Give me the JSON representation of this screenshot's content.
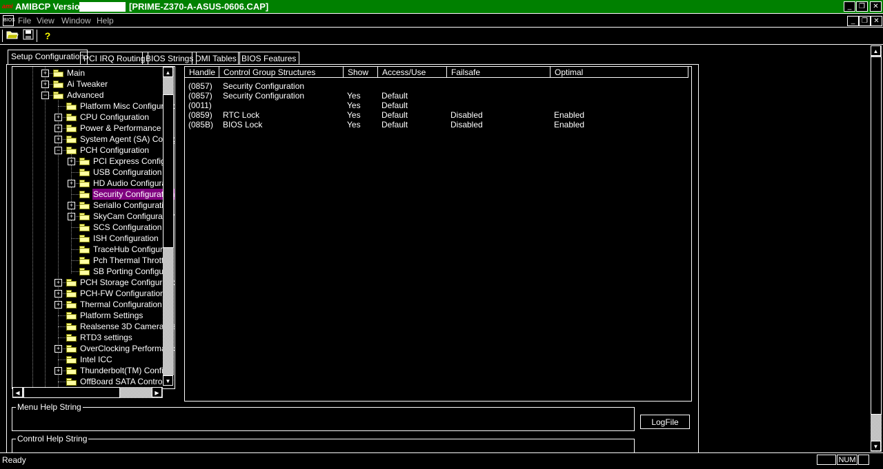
{
  "window": {
    "title_prefix": "AMIBCP Version",
    "title_file": "[PRIME-Z370-A-ASUS-0606.CAP]",
    "logo": "ami",
    "minimize_icon": "minimize-icon",
    "restore_icon": "restore-icon",
    "close_icon": "close-icon"
  },
  "menu": {
    "logo": "BIOS",
    "items": [
      "File",
      "View",
      "Window",
      "Help"
    ]
  },
  "toolbar": {
    "icons": [
      "open-folder-icon",
      "save-icon",
      "help-icon"
    ]
  },
  "tabs": [
    "Setup Configuration",
    "PCI IRQ Routing",
    "BIOS Strings",
    "DMI Tables",
    "BIOS Features"
  ],
  "active_tab": "Setup Configuration",
  "tree": {
    "items": [
      {
        "label": "Main",
        "level": 0,
        "expander": "+"
      },
      {
        "label": "Ai Tweaker",
        "level": 0,
        "expander": "+"
      },
      {
        "label": "Advanced",
        "level": 0,
        "expander": "-"
      },
      {
        "label": "Platform Misc Configuratio",
        "level": 1,
        "expander": ""
      },
      {
        "label": "CPU Configuration",
        "level": 1,
        "expander": "+"
      },
      {
        "label": "Power & Performance",
        "level": 1,
        "expander": "+"
      },
      {
        "label": "System Agent (SA) Config",
        "level": 1,
        "expander": "+"
      },
      {
        "label": "PCH Configuration",
        "level": 1,
        "expander": "-"
      },
      {
        "label": "PCI Express Configur",
        "level": 2,
        "expander": "+"
      },
      {
        "label": "USB Configuration",
        "level": 2,
        "expander": ""
      },
      {
        "label": "HD Audio Configurati",
        "level": 2,
        "expander": "+"
      },
      {
        "label": "Security Configuration",
        "level": 2,
        "expander": "",
        "selected": true
      },
      {
        "label": "SerialIo Configuration",
        "level": 2,
        "expander": "+"
      },
      {
        "label": "SkyCam Configuration",
        "level": 2,
        "expander": "+"
      },
      {
        "label": "SCS Configuration",
        "level": 2,
        "expander": ""
      },
      {
        "label": "ISH Configuration",
        "level": 2,
        "expander": ""
      },
      {
        "label": "TraceHub Configurati",
        "level": 2,
        "expander": ""
      },
      {
        "label": "Pch Thermal Throttlin",
        "level": 2,
        "expander": ""
      },
      {
        "label": "SB Porting Configurat",
        "level": 2,
        "expander": ""
      },
      {
        "label": "PCH Storage Configuratio",
        "level": 1,
        "expander": "+"
      },
      {
        "label": "PCH-FW Configuration",
        "level": 1,
        "expander": "+"
      },
      {
        "label": "Thermal Configuration",
        "level": 1,
        "expander": "+"
      },
      {
        "label": "Platform Settings",
        "level": 1,
        "expander": ""
      },
      {
        "label": "Realsense 3D Camera Se",
        "level": 1,
        "expander": ""
      },
      {
        "label": "RTD3 settings",
        "level": 1,
        "expander": ""
      },
      {
        "label": "OverClocking Performanc",
        "level": 1,
        "expander": "+"
      },
      {
        "label": "Intel ICC",
        "level": 1,
        "expander": ""
      },
      {
        "label": "Thunderbolt(TM) Configu",
        "level": 1,
        "expander": "+"
      },
      {
        "label": "OffBoard SATA Controller",
        "level": 1,
        "expander": ""
      }
    ]
  },
  "grid": {
    "columns": [
      "Handle",
      "Control Group Structures",
      "Show",
      "Access/Use",
      "Failsafe",
      "Optimal"
    ],
    "rows": [
      [
        "(0857)",
        "Security Configuration",
        "",
        "",
        "",
        ""
      ],
      [
        "(0857)",
        "Security Configuration",
        "Yes",
        "Default",
        "",
        ""
      ],
      [
        "(0011)",
        "",
        "Yes",
        "Default",
        "",
        ""
      ],
      [
        "(0859)",
        "RTC Lock",
        "Yes",
        "Default",
        "Disabled",
        "Enabled"
      ],
      [
        "(085B)",
        "BIOS Lock",
        "Yes",
        "Default",
        "Disabled",
        "Enabled"
      ]
    ]
  },
  "help": {
    "menu_help_label": "Menu Help String",
    "control_help_label": "Control Help String",
    "logfile_button": "LogFile"
  },
  "status": {
    "text": "Ready",
    "num": "NUM"
  }
}
